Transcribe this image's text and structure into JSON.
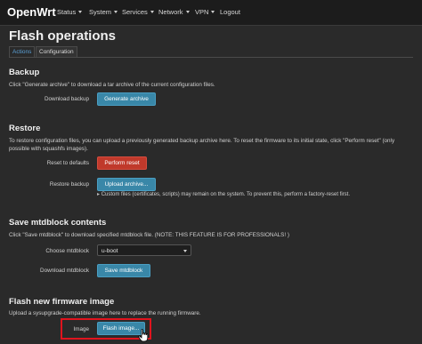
{
  "header": {
    "brand": "OpenWrt",
    "nav": [
      {
        "label": "Status",
        "dropdown": true
      },
      {
        "label": "System",
        "dropdown": true
      },
      {
        "label": "Services",
        "dropdown": true
      },
      {
        "label": "Network",
        "dropdown": true
      },
      {
        "label": "VPN",
        "dropdown": true
      },
      {
        "label": "Logout",
        "dropdown": false
      }
    ]
  },
  "page": {
    "title": "Flash operations",
    "tabs": [
      {
        "label": "Actions",
        "active": true
      },
      {
        "label": "Configuration",
        "active": false
      }
    ]
  },
  "backup": {
    "title": "Backup",
    "description": "Click \"Generate archive\" to download a tar archive of the current configuration files.",
    "download_label": "Download backup",
    "generate_button": "Generate archive"
  },
  "restore": {
    "title": "Restore",
    "description": "To restore configuration files, you can upload a previously generated backup archive here. To reset the firmware to its initial state, click \"Perform reset\" (only possible with squashfs images).",
    "reset_label": "Reset to defaults",
    "reset_button": "Perform reset",
    "restore_label": "Restore backup",
    "upload_button": "Upload archive...",
    "upload_note": "Custom files (certificates, scripts) may remain on the system. To prevent this, perform a factory-reset first."
  },
  "mtdblock": {
    "title": "Save mtdblock contents",
    "description": "Click \"Save mtdblock\" to download specified mtdblock file. (NOTE: THIS FEATURE IS FOR PROFESSIONALS! )",
    "choose_label": "Choose mtdblock",
    "selected": "u-boot",
    "download_label": "Download mtdblock",
    "save_button": "Save mtdblock"
  },
  "flash": {
    "title": "Flash new firmware image",
    "description": "Upload a sysupgrade-compatible image here to replace the running firmware.",
    "image_label": "Image",
    "flash_button": "Flash image..."
  },
  "colors": {
    "primary_button": "#3987a8",
    "danger_button": "#c0392b",
    "highlight": "#e0141e",
    "active_tab": "#5aa0d6"
  }
}
